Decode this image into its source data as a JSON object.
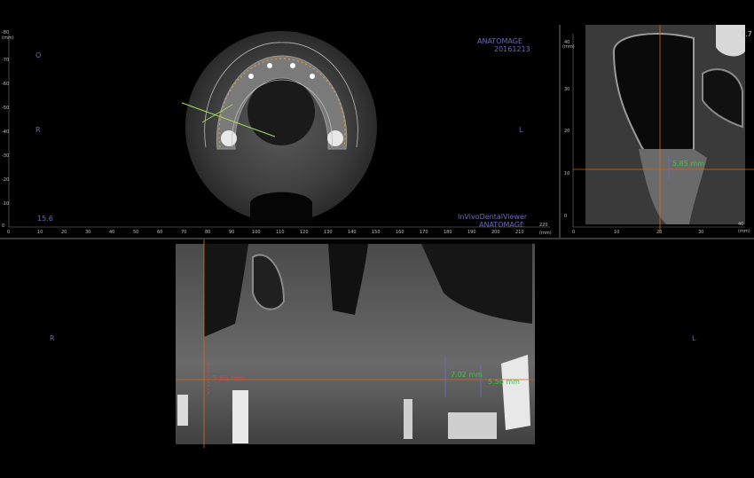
{
  "axial": {
    "brand": "ANATOMAGE",
    "date": "20161213",
    "orientation_top": "O",
    "orientation_left": "R",
    "orientation_right": "L",
    "slice_value": "15.6",
    "viewer_name": "InVivoDentalViewer",
    "viewer_brand": "ANATOMAGE",
    "y_unit": "(mm)",
    "x_unit": "(mm)",
    "y_ticks": [
      "-80",
      "-70",
      "-60",
      "-50",
      "-40",
      "-30",
      "-20",
      "-10",
      "0"
    ],
    "x_ticks": [
      "0",
      "10",
      "20",
      "30",
      "40",
      "50",
      "60",
      "70",
      "80",
      "90",
      "100",
      "110",
      "120",
      "130",
      "140",
      "150",
      "160",
      "170",
      "180",
      "190",
      "200",
      "210",
      "220"
    ]
  },
  "sagittal": {
    "orientation_right": "6.7",
    "measurement": "5.85 mm",
    "y_unit": "(mm)",
    "x_unit": "(mm)",
    "y_ticks": [
      "40",
      "30",
      "20",
      "10",
      "0"
    ],
    "x_ticks": [
      "0",
      "10",
      "20",
      "30",
      "40"
    ]
  },
  "coronal": {
    "orientation_left": "R",
    "orientation_right": "L",
    "measurements": [
      "5.85 mm",
      "7.02 mm",
      "5.56 mm"
    ]
  },
  "colors": {
    "label": "#6b6bb8",
    "crosshair": "#d2691e",
    "measure_green": "#33cc33",
    "measure_red": "#e04040",
    "curve": "#f0a030",
    "axis_line": "#a8e060"
  }
}
